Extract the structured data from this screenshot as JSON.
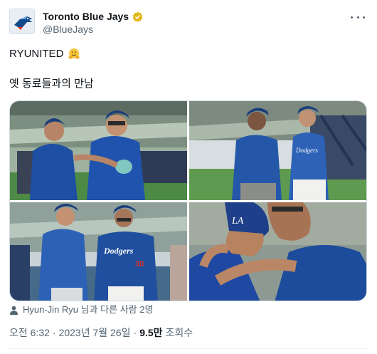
{
  "account": {
    "display_name": "Toronto Blue Jays",
    "handle": "@BlueJays",
    "avatar_icon": "blue-jays-logo-icon",
    "verified_icon": "verified-gold-badge-icon",
    "more_icon": "more-options-icon"
  },
  "tweet": {
    "line1": "RYUNITED",
    "line1_emoji": "hugging-face-emoji",
    "line2": "옛 동료들과의 만남"
  },
  "media": {
    "photos": [
      {
        "name": "photo-1"
      },
      {
        "name": "photo-2"
      },
      {
        "name": "photo-3"
      },
      {
        "name": "photo-4"
      }
    ]
  },
  "tagged": {
    "icon": "person-icon",
    "text": "Hyun-Jin Ryu 님과 다른 사람 2명"
  },
  "meta": {
    "time": "오전 6:32",
    "separator": "·",
    "date": "2023년 7월 26일",
    "views_value": "9.5만",
    "views_label": "조회수"
  },
  "colors": {
    "text": "#0f1419",
    "secondary": "#536471",
    "border": "#cfd9de",
    "jays_blue": "#134a8e",
    "dodgers_blue": "#005a9c"
  }
}
